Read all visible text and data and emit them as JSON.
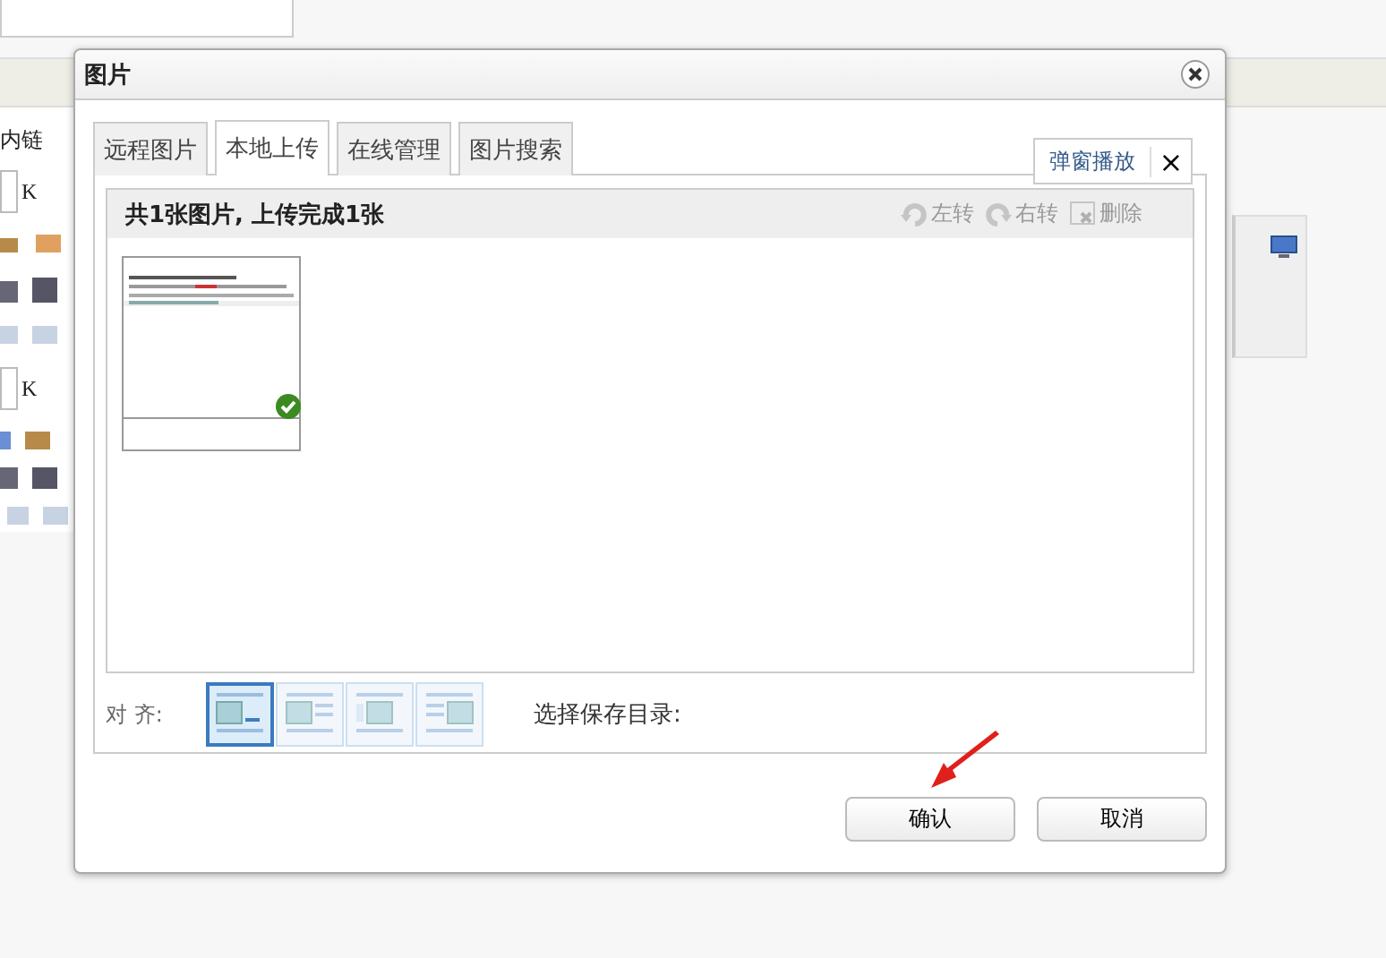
{
  "background": {
    "link_label": "内链",
    "size_unit": "K",
    "size_unit_2": "K"
  },
  "dialog": {
    "title": "图片",
    "tabs": [
      {
        "label": "远程图片",
        "selected": false
      },
      {
        "label": "本地上传",
        "selected": true
      },
      {
        "label": "在线管理",
        "selected": false
      },
      {
        "label": "图片搜索",
        "selected": false
      }
    ],
    "float_tip": {
      "label": "弹窗播放",
      "close": "×"
    },
    "summary": "共1张图片, 上传完成1张",
    "actions": [
      {
        "kind": "rotate-left",
        "label": "左转",
        "disabled": true
      },
      {
        "kind": "rotate-right",
        "label": "右转",
        "disabled": true
      },
      {
        "kind": "delete",
        "label": "删除",
        "disabled": true
      }
    ],
    "images": [
      {
        "uploaded": true
      }
    ],
    "align": {
      "label": "对 齐:",
      "options": [
        {
          "kind": "none",
          "selected": true
        },
        {
          "kind": "left",
          "selected": false
        },
        {
          "kind": "center",
          "selected": false
        },
        {
          "kind": "right",
          "selected": false
        }
      ]
    },
    "save_dir_label": "选择保存目录:",
    "buttons": [
      "确认",
      "取消"
    ]
  }
}
